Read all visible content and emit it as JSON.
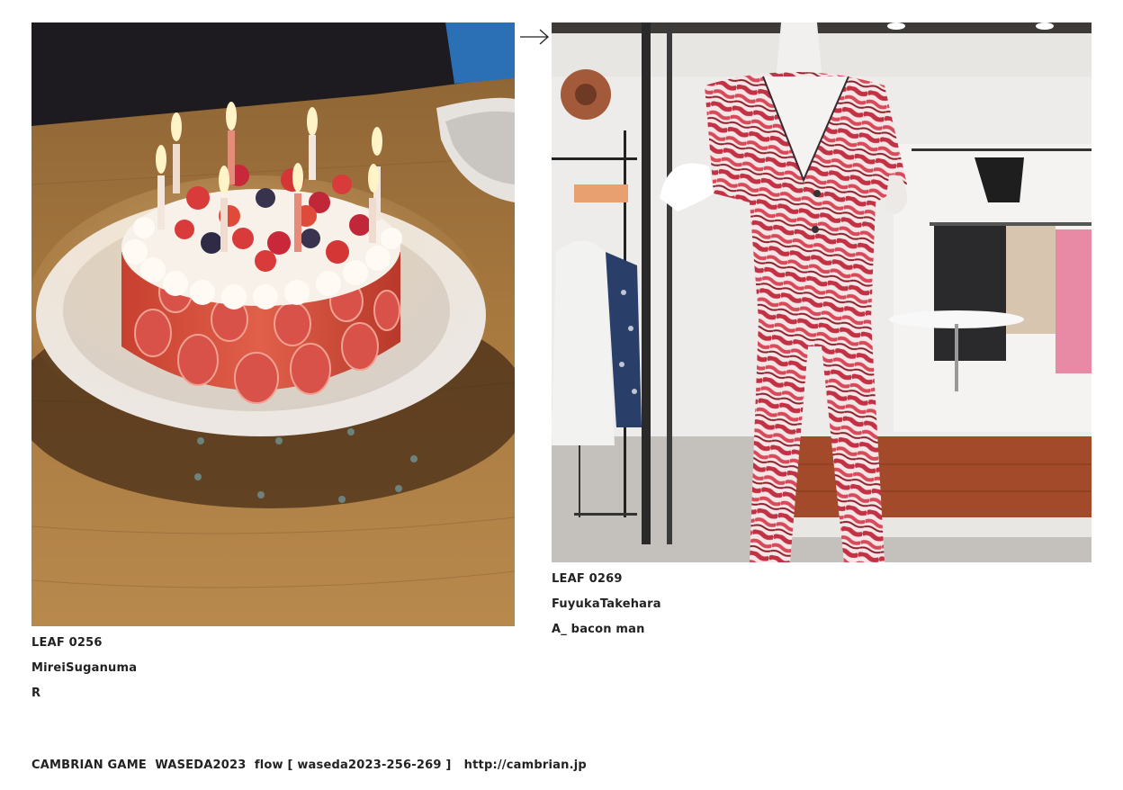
{
  "entries": [
    {
      "leaf": "LEAF 0256",
      "author": "MireiSuganuma",
      "title": "R",
      "image": "birthday-cake-with-candles-photo"
    },
    {
      "leaf": "LEAF 0269",
      "author": "FuyukaTakehara",
      "title": "A_ bacon man",
      "image": "mannequin-in-red-striped-jumpsuit-photo"
    }
  ],
  "flow_arrow": "arrow-right-icon",
  "footer": {
    "text": "CAMBRIAN GAME  WASEDA2023  flow [ waseda2023-256-269 ]   ",
    "link": "http://cambrian.jp"
  }
}
